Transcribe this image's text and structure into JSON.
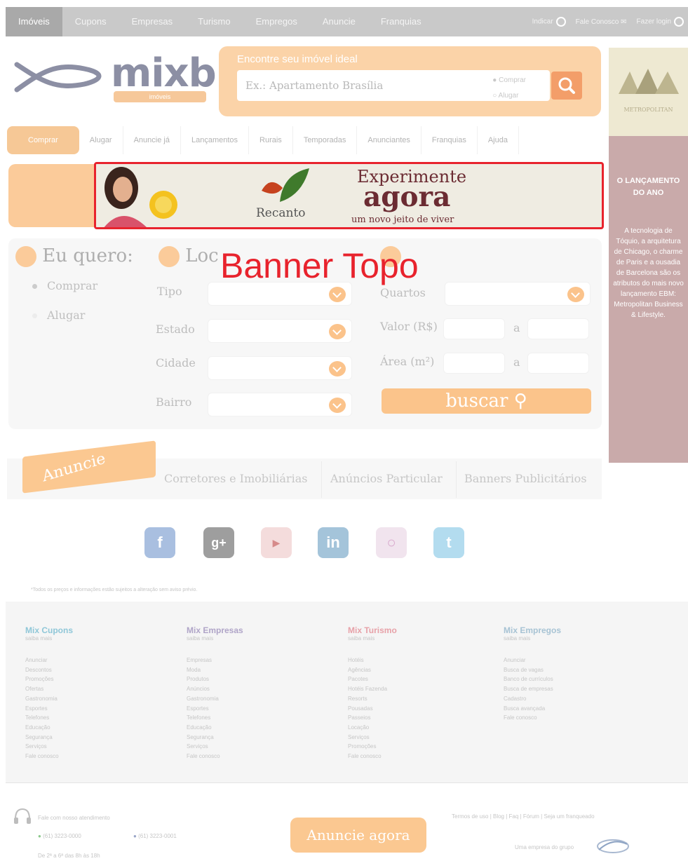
{
  "topnav": {
    "tabs": [
      "Imóveis",
      "Cupons",
      "Empresas",
      "Turismo",
      "Empregos",
      "Anuncie",
      "Franquias"
    ],
    "right": [
      "Indicar",
      "Fale Conosco",
      "Fazer login"
    ]
  },
  "logo": {
    "word": "mixbr",
    "sub": "imóveis"
  },
  "search": {
    "title": "Encontre seu imóvel ideal",
    "placeholder": "Ex.: Apartamento Brasília",
    "opt_buy": "Comprar",
    "opt_rent": "Alugar"
  },
  "ad": {
    "brand": "METROPOLITAN",
    "heading": "O LANÇAMENTO DO ANO",
    "body": "A tecnologia de Tóquio, a arquitetura de Chicago, o charme de Paris e a ousadia de Barcelona são os atributos do mais novo lançamento EBM: Metropolitan Business & Lifestyle."
  },
  "category_tabs": [
    "Comprar",
    "Alugar",
    "Anuncie já",
    "Lançamentos",
    "Rurais",
    "Temporadas",
    "Anunciantes",
    "Franquias",
    "Ajuda"
  ],
  "banner": {
    "line1": "Experimente",
    "line2": "agora",
    "line3": "um novo jeito de viver",
    "brand": "Recanto"
  },
  "banner_annotation": "Banner Topo",
  "filters": {
    "step1": "Eu quero:",
    "step2": "Loc",
    "step3": "...",
    "radio_buy": "Comprar",
    "radio_rent": "Alugar",
    "tipo": "Tipo",
    "estado": "Estado",
    "cidade": "Cidade",
    "bairro": "Bairro",
    "quartos": "Quartos",
    "valor": "Valor (R$)",
    "area": "Área (m²)",
    "a": "a",
    "search_btn": "buscar"
  },
  "anuncie": {
    "tag": "Anuncie",
    "links": [
      "Corretores e Imobiliárias",
      "Anúncios Particular",
      "Banners Publicitários"
    ]
  },
  "social": [
    "f",
    "g+",
    "yt",
    "in",
    "o",
    "t"
  ],
  "disclaimer": "*Todos os preços e informações estão sujeitos a alteração sem aviso prévio.",
  "footer": {
    "cols": [
      {
        "title": "Mix Cupons",
        "sub": "saiba mais",
        "color": "#8fc7d8",
        "items": [
          "Anunciar",
          "Descontos",
          "Promoções",
          "Ofertas",
          "Gastronomia",
          "Esportes",
          "Telefones",
          "Educação",
          "Segurança",
          "Serviços",
          "Fale conosco"
        ]
      },
      {
        "title": "Mix Empresas",
        "sub": "saiba mais",
        "color": "#b0a5c8",
        "items": [
          "Empresas",
          "Moda",
          "Produtos",
          "Anúncios",
          "Gastronomia",
          "Esportes",
          "Telefones",
          "Educação",
          "Segurança",
          "Serviços",
          "Fale conosco"
        ]
      },
      {
        "title": "Mix Turismo",
        "sub": "saiba mais",
        "color": "#e7a1a8",
        "items": [
          "Hotéis",
          "Agências",
          "Pacotes",
          "Hotéis Fazenda",
          "Resorts",
          "Pousadas",
          "Passeios",
          "Locação",
          "Serviços",
          "Promoções",
          "Fale conosco"
        ]
      },
      {
        "title": "Mix Empregos",
        "sub": "saiba mais",
        "color": "#a7c3d4",
        "items": [
          "Anunciar",
          "Busca de vagas",
          "Banco de currículos",
          "Busca de empresas",
          "Cadastro",
          "Busca avançada",
          "Fale conosco"
        ]
      }
    ]
  },
  "bottom": {
    "contact": "Fale com nosso atendimento",
    "phone1": "(61) 3223-0000",
    "phone2": "(61) 3223-0001",
    "hours": "De 2ª a 6ª das 8h às 18h",
    "links": "Termos de uso  |  Blog  |  Faq  |  Fórum  |  Seja um franqueado",
    "group": "Uma empresa do grupo",
    "cta": "Anuncie agora"
  }
}
